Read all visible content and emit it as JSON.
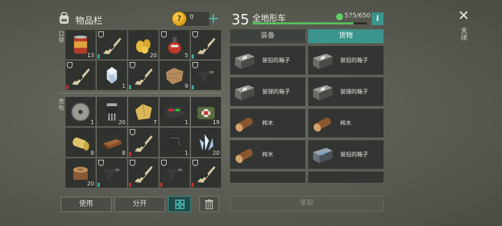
{
  "inventory": {
    "title": "物品栏",
    "coins": "0",
    "pockets_label": "口袋",
    "backpack_label": "背包",
    "pockets": [
      {
        "item": "canned-food",
        "count": "13"
      },
      {
        "item": "rifle",
        "count": "",
        "guard": true,
        "dur": "ok"
      },
      {
        "item": "corn",
        "count": "20"
      },
      {
        "item": "gas-canister",
        "count": "5",
        "guard": true
      },
      {
        "item": "rifle",
        "count": "",
        "guard": true,
        "dur": "ok"
      },
      {
        "item": "rifle",
        "count": "",
        "guard": true,
        "dur": "low"
      },
      {
        "item": "crystal",
        "count": "1"
      },
      {
        "item": "rifle",
        "count": "",
        "guard": true,
        "dur": "ok"
      },
      {
        "item": "leather-scrap",
        "count": "9"
      },
      {
        "item": "pistol",
        "count": "",
        "guard": true,
        "dur": "ok"
      }
    ],
    "backpack": [
      {
        "item": "saw-blade",
        "count": "1"
      },
      {
        "item": "transistor",
        "count": "20"
      },
      {
        "item": "cloth",
        "count": "7"
      },
      {
        "item": "battery-kit",
        "count": "1"
      },
      {
        "item": "first-aid-kit",
        "count": "19"
      },
      {
        "item": "fabric-roll",
        "count": "8"
      },
      {
        "item": "plank",
        "count": "8"
      },
      {
        "item": "rifle",
        "count": "",
        "guard": true,
        "dur": "low"
      },
      {
        "item": "metal-sheet",
        "count": "1"
      },
      {
        "item": "crystal-cluster",
        "count": "20"
      },
      {
        "item": "log-stump",
        "count": "20"
      },
      {
        "item": "pistol",
        "count": "",
        "guard": true,
        "dur": "ok"
      },
      {
        "item": "rifle",
        "count": "",
        "guard": true,
        "dur": "low"
      },
      {
        "item": "pistol",
        "count": "",
        "guard": true,
        "dur": "low"
      },
      {
        "item": "rifle",
        "count": "",
        "guard": true,
        "dur": "low"
      }
    ],
    "buttons": {
      "use": "使用",
      "split": "分开"
    }
  },
  "vehicle": {
    "level": "35",
    "name": "全地形车",
    "capacity": "575/650",
    "capacity_fraction": 0.885,
    "info": "i",
    "tabs": {
      "equipment": "装备",
      "cargo": "货物"
    },
    "cargo": [
      {
        "item": "crate",
        "label": "装铅的箱子"
      },
      {
        "item": "crate",
        "label": "装铅的箱子"
      },
      {
        "item": "crate",
        "label": "装锑的箱子"
      },
      {
        "item": "crate",
        "label": "装锑的箱子"
      },
      {
        "item": "log",
        "label": "榨木"
      },
      {
        "item": "log",
        "label": "榨木"
      },
      {
        "item": "log",
        "label": "榨木"
      },
      {
        "item": "crate-blue",
        "label": "装铅的箱子"
      }
    ],
    "take": "拿取"
  },
  "close_label": "关闭",
  "colors": {
    "accent": "#3b948d",
    "bar": "#58c15b",
    "durability_low": "#c9302c"
  }
}
